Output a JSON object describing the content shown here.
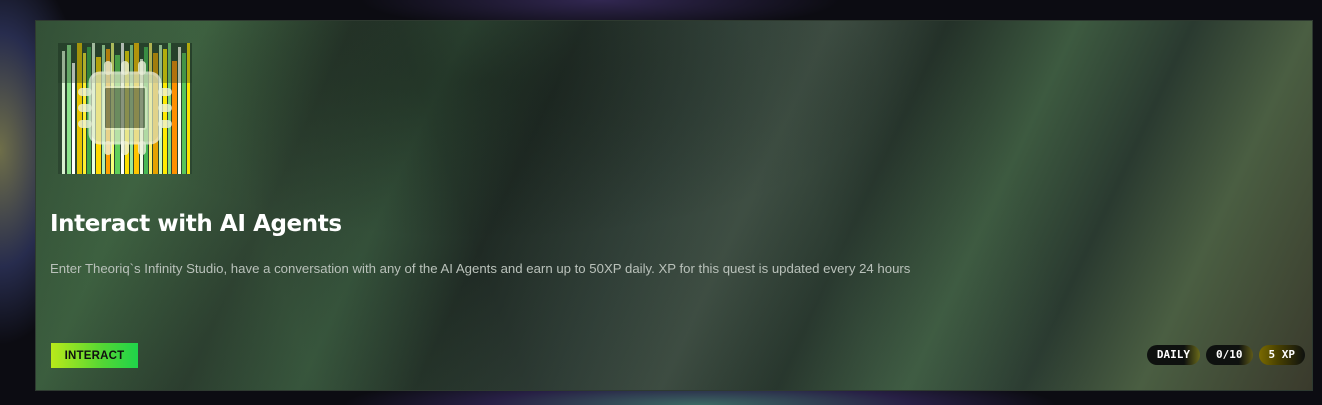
{
  "quest": {
    "title": "Interact with AI Agents",
    "description": "Enter Theoriq`s Infinity Studio, have a conversation with any of the AI Agents and earn up to 50XP daily. XP for this quest is updated every 24 hours",
    "action_label": "INTERACT",
    "badges": {
      "frequency": "DAILY",
      "progress": "0/10",
      "reward": "5 XP"
    },
    "thumbnail_icon": "cpu-chip-icon"
  },
  "colors": {
    "action_button": "#52d635",
    "reward_badge": "#7a6a00"
  }
}
